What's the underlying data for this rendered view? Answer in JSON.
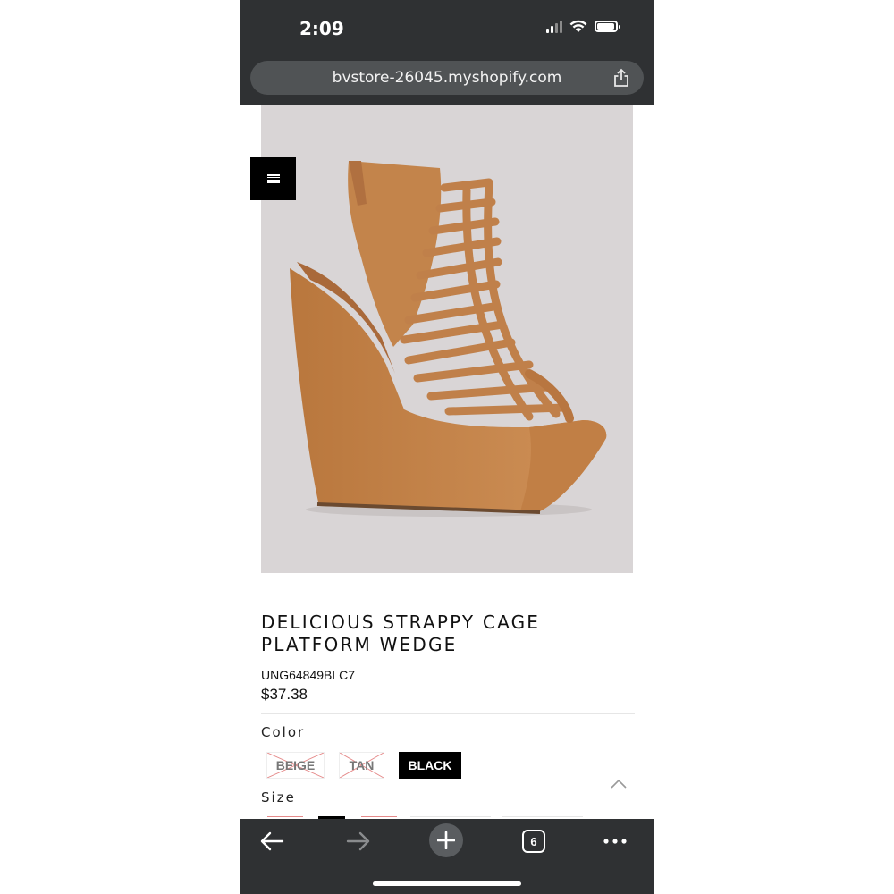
{
  "status_bar": {
    "time": "2:09"
  },
  "browser": {
    "url": "bvstore-26045.myshopify.com",
    "open_tabs": "6"
  },
  "product": {
    "title": "DELICIOUS STRAPPY CAGE PLATFORM WEDGE",
    "sku": "UNG64849BLC7",
    "price": "$37.38",
    "image_background": "#d9d5d6",
    "shoe_color": "#c88950"
  },
  "options": {
    "color_label": "Color",
    "colors": [
      {
        "label": "BEIGE",
        "available": false
      },
      {
        "label": "TAN",
        "available": false
      },
      {
        "label": "BLACK",
        "available": true,
        "selected": true
      }
    ],
    "size_label": "Size"
  },
  "icons": {
    "menu": "hamburger-icon",
    "share": "share-icon",
    "back": "back-arrow-icon",
    "forward": "forward-arrow-icon",
    "new_tab": "plus-icon",
    "tabs": "tabs-icon",
    "more": "more-icon",
    "scroll_top": "chevron-up-icon"
  },
  "colors": {
    "toolbar": "#2f3133",
    "url_field": "#505355",
    "unavailable_strike": "#e58a8a"
  }
}
